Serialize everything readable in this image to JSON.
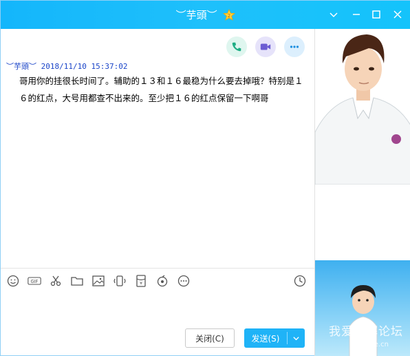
{
  "window": {
    "title": "︶芋頭︶",
    "level_badge": "2"
  },
  "chat": {
    "message": {
      "sender": "︶芋頭︶",
      "timestamp": "2018/11/10 15:37:02",
      "text": "哥用你的挂很长时间了。辅助的１３和１６最稳为什么要去掉哦？特别是１６的红点，大号用都查不出来的。至少把１６的红点保留一下啊哥"
    }
  },
  "toolbar": {
    "tools": [
      "emoji-icon",
      "gif-icon",
      "scissors-icon",
      "folder-icon",
      "image-icon",
      "shake-icon",
      "red-packet-icon",
      "music-icon",
      "more-icon"
    ],
    "history_icon": "clock-icon"
  },
  "buttons": {
    "close_label": "关闭(C)",
    "send_label": "发送(S)"
  },
  "watermark": {
    "text": "我爱破解论坛",
    "sub": "52pojie.cn"
  },
  "colors": {
    "titlebar": "#1ec0fb",
    "send_button": "#1fb3f7",
    "sender_text": "#1a44c8"
  }
}
